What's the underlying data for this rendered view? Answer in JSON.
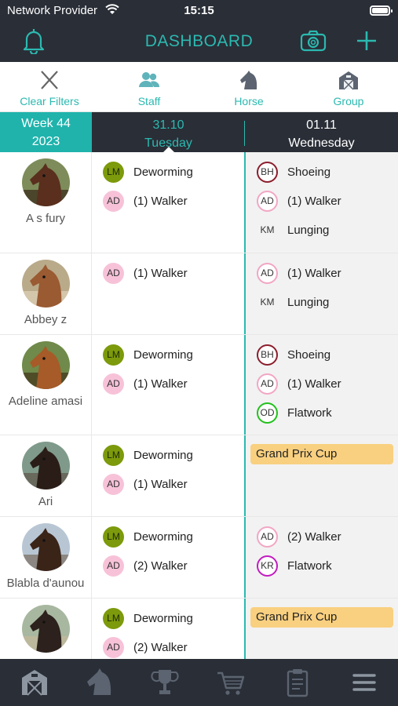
{
  "status_bar": {
    "carrier": "Network Provider",
    "time": "15:15"
  },
  "header": {
    "title": "DASHBOARD",
    "icons": [
      "bell-icon",
      "camera-icon",
      "plus-icon"
    ]
  },
  "filters": [
    {
      "label": "Clear Filters",
      "icon": "close-icon"
    },
    {
      "label": "Staff",
      "icon": "people-icon"
    },
    {
      "label": "Horse",
      "icon": "horse-head-icon"
    },
    {
      "label": "Group",
      "icon": "barn-icon"
    }
  ],
  "week": {
    "week": "Week 44",
    "year": "2023"
  },
  "days": [
    {
      "date": "31.10",
      "weekday": "Tuesday",
      "selected": true
    },
    {
      "date": "01.11",
      "weekday": "Wednesday",
      "selected": false
    }
  ],
  "rows": [
    {
      "name": "A s fury",
      "day1": [
        {
          "badge": "LM",
          "label": "Deworming"
        },
        {
          "badge": "AD",
          "label": "(1) Walker"
        }
      ],
      "day2": [
        {
          "badge": "BH",
          "label": "Shoeing"
        },
        {
          "badge": "AD",
          "label": "(1) Walker"
        },
        {
          "badge": "KM",
          "label": "Lunging"
        }
      ]
    },
    {
      "name": "Abbey z",
      "day1": [
        {
          "badge": "AD",
          "label": "(1) Walker"
        }
      ],
      "day2": [
        {
          "badge": "AD",
          "label": "(1) Walker"
        },
        {
          "badge": "KM",
          "label": "Lunging"
        }
      ]
    },
    {
      "name": "Adeline amasi",
      "day1": [
        {
          "badge": "LM",
          "label": "Deworming"
        },
        {
          "badge": "AD",
          "label": "(1) Walker"
        }
      ],
      "day2": [
        {
          "badge": "BH",
          "label": "Shoeing"
        },
        {
          "badge": "AD",
          "label": "(1) Walker"
        },
        {
          "badge": "OD",
          "label": "Flatwork"
        }
      ]
    },
    {
      "name": "Ari",
      "day1": [
        {
          "badge": "LM",
          "label": "Deworming"
        },
        {
          "badge": "AD",
          "label": "(1) Walker"
        }
      ],
      "day2_event": "Grand Prix Cup"
    },
    {
      "name": "Blabla d'aunou",
      "day1": [
        {
          "badge": "LM",
          "label": "Deworming"
        },
        {
          "badge": "AD",
          "label": "(2) Walker"
        }
      ],
      "day2": [
        {
          "badge": "AD",
          "label": "(2) Walker"
        },
        {
          "badge": "KR",
          "label": "Flatwork"
        }
      ]
    },
    {
      "name": "",
      "day1": [
        {
          "badge": "LM",
          "label": "Deworming"
        },
        {
          "badge": "AD",
          "label": "(2) Walker"
        }
      ],
      "day2_event": "Grand Prix Cup"
    }
  ],
  "tabbar": [
    "barn-icon",
    "horse-head-icon",
    "trophy-icon",
    "cart-icon",
    "clipboard-icon",
    "menu-icon"
  ],
  "colors": {
    "accent": "#2bb9b0",
    "dark": "#2a2e37",
    "event": "#f9d080"
  }
}
